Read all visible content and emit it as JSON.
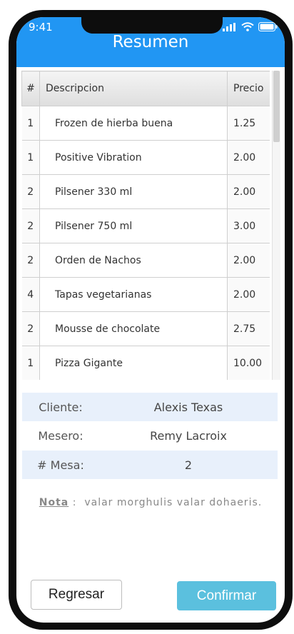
{
  "status": {
    "time": "9:41"
  },
  "header": {
    "title": "Resumen"
  },
  "table": {
    "headers": {
      "qty": "#",
      "desc": "Descripcion",
      "price": "Precio"
    },
    "rows": [
      {
        "qty": "1",
        "desc": "Frozen de hierba buena",
        "price": "1.25"
      },
      {
        "qty": "1",
        "desc": "Positive Vibration",
        "price": "2.00"
      },
      {
        "qty": "2",
        "desc": "Pilsener 330 ml",
        "price": "2.00"
      },
      {
        "qty": "2",
        "desc": "Pilsener 750 ml",
        "price": "3.00"
      },
      {
        "qty": "2",
        "desc": "Orden de Nachos",
        "price": "2.00"
      },
      {
        "qty": "4",
        "desc": "Tapas vegetarianas",
        "price": "2.00"
      },
      {
        "qty": "2",
        "desc": "Mousse de chocolate",
        "price": "2.75"
      },
      {
        "qty": "1",
        "desc": "Pizza Gigante",
        "price": "10.00"
      }
    ]
  },
  "info": {
    "cliente_label": "Cliente:",
    "cliente": "Alexis Texas",
    "mesero_label": "Mesero:",
    "mesero": "Remy Lacroix",
    "mesa_label": "# Mesa:",
    "mesa": "2"
  },
  "nota": {
    "label": "Nota",
    "separator": ":",
    "text": "valar morghulis valar dohaeris."
  },
  "buttons": {
    "back": "Regresar",
    "confirm": "Confirmar"
  },
  "colors": {
    "appbar": "#2196f3",
    "confirm": "#5bc0de",
    "info_alt": "#e8f0fb"
  },
  "icons": [
    "signal-icon",
    "wifi-icon",
    "battery-icon"
  ]
}
